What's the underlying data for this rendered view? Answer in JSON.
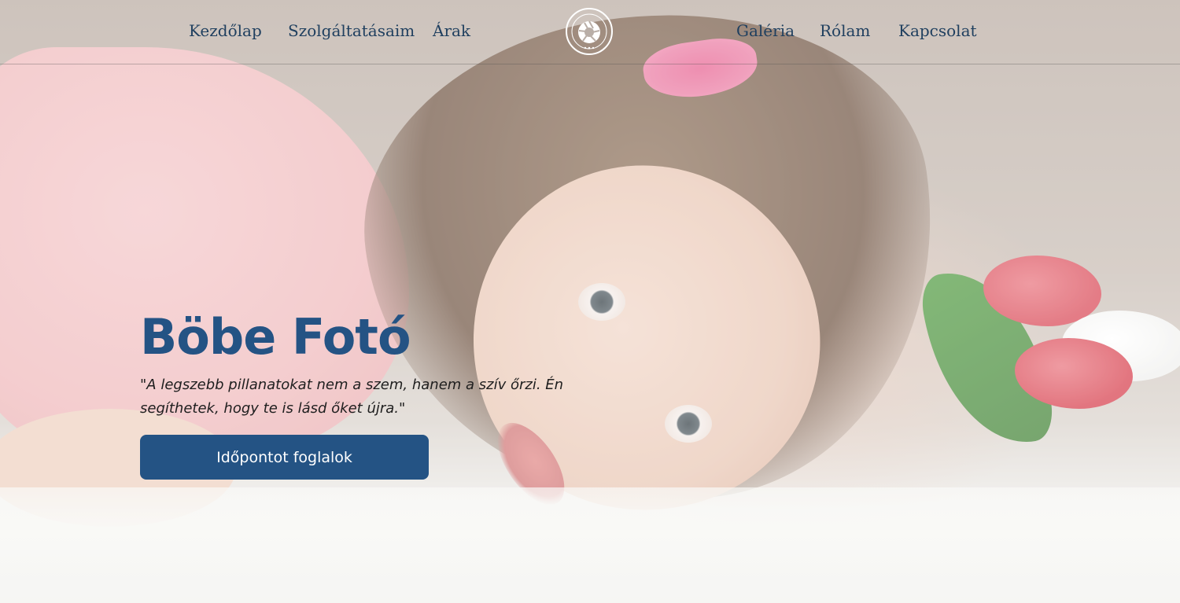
{
  "nav": {
    "items": [
      {
        "label": "Kezdőlap"
      },
      {
        "label": "Szolgáltatásaim"
      },
      {
        "label": "Árak"
      },
      {
        "label": "Galéria"
      },
      {
        "label": "Rólam"
      },
      {
        "label": "Kapcsolat"
      }
    ],
    "logo_icon": "camera-aperture-logo-icon"
  },
  "hero": {
    "title": "Böbe Fotó",
    "quote": "\"A legszebb pillanatokat nem a szem, hanem a szív őrzi. Én segíthetek, hogy te is lásd őket újra.\"",
    "cta_label": "Időpontot foglalok"
  },
  "colors": {
    "brand_blue": "#245384",
    "nav_text": "#1f3f5f",
    "button_text": "#ffffff"
  }
}
